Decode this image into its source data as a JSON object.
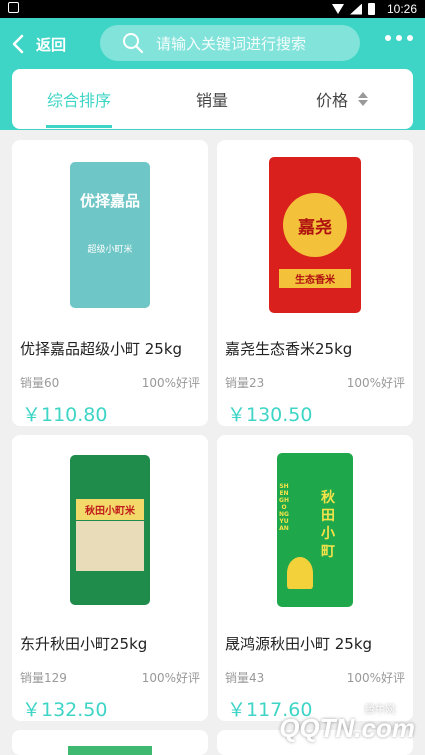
{
  "status_bar": {
    "time": "10:26"
  },
  "header": {
    "back_label": "返回",
    "search_placeholder": "请输入关键词进行搜索",
    "accent_color": "#3ed5c6"
  },
  "sort_tabs": [
    {
      "label": "综合排序",
      "active": true
    },
    {
      "label": "销量",
      "active": false
    },
    {
      "label": "价格",
      "active": false
    }
  ],
  "products": [
    {
      "name": "优择嘉品超级小町 25kg",
      "sales": "销量60",
      "rating": "100%好评",
      "price": "￥110.80",
      "bag_text": "优择嘉品",
      "bag_sub": "超级小町米",
      "bag_color": "#6fc6c6"
    },
    {
      "name": "嘉尧生态香米25kg",
      "sales": "销量23",
      "rating": "100%好评",
      "price": "￥130.50",
      "bag_text": "嘉尧",
      "bag_sub": "生态香米",
      "bag_color": "#d9201c"
    },
    {
      "name": "东升秋田小町25kg",
      "sales": "销量129",
      "rating": "100%好评",
      "price": "￥132.50",
      "bag_text": "秋田小町米",
      "bag_sub": "",
      "bag_color": "#1f8c4b"
    },
    {
      "name": "晟鸿源秋田小町 25kg",
      "sales": "销量43",
      "rating": "100%好评",
      "price": "￥117.60",
      "bag_text": "秋田小町",
      "bag_sub": "SHENGHONGYUAN",
      "bag_color": "#1fa84b"
    }
  ],
  "watermark": {
    "small": "腾牛网",
    "big": "QQTN.com"
  }
}
